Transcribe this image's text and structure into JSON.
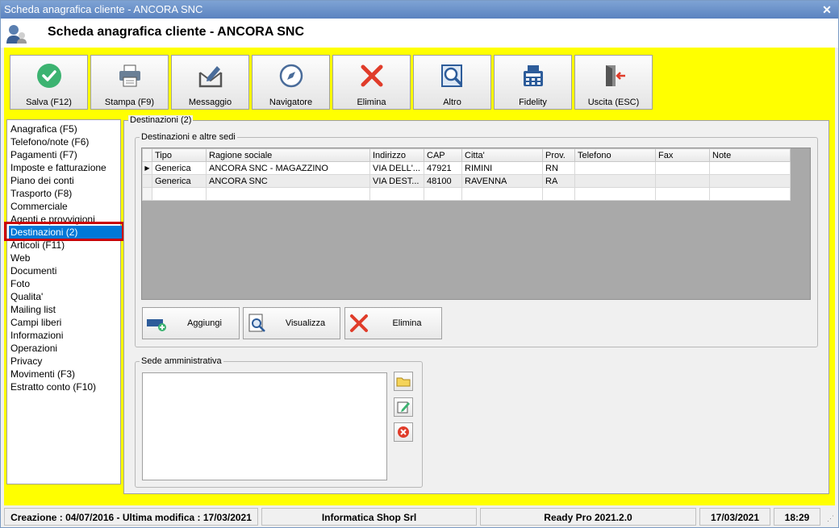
{
  "window": {
    "title": "Scheda anagrafica cliente - ANCORA SNC"
  },
  "header": {
    "title": "Scheda anagrafica cliente - ANCORA SNC"
  },
  "toolbar": [
    {
      "label": "Salva (F12)",
      "icon": "check-icon"
    },
    {
      "label": "Stampa (F9)",
      "icon": "printer-icon"
    },
    {
      "label": "Messaggio",
      "icon": "message-icon"
    },
    {
      "label": "Navigatore",
      "icon": "compass-icon"
    },
    {
      "label": "Elimina",
      "icon": "delete-icon"
    },
    {
      "label": "Altro",
      "icon": "search-doc-icon"
    },
    {
      "label": "Fidelity",
      "icon": "cash-register-icon"
    },
    {
      "label": "Uscita (ESC)",
      "icon": "exit-icon"
    }
  ],
  "nav": {
    "items": [
      "Anagrafica (F5)",
      "Telefono/note (F6)",
      "Pagamenti (F7)",
      "Imposte e fatturazione",
      "Piano dei conti",
      "Trasporto (F8)",
      "Commerciale",
      "Agenti e provvigioni",
      "Destinazioni (2)",
      "Articoli (F11)",
      "Web",
      "Documenti",
      "Foto",
      "Qualita'",
      "Mailing list",
      "Campi liberi",
      "Informazioni",
      "Operazioni",
      "Privacy",
      "Movimenti (F3)",
      "Estratto conto (F10)"
    ],
    "selected": "Destinazioni (2)"
  },
  "panel": {
    "title": "Destinazioni (2)",
    "group_title": "Destinazioni e altre sedi",
    "admin_title": "Sede amministrativa"
  },
  "table": {
    "columns": [
      "Tipo",
      "Ragione sociale",
      "Indirizzo",
      "CAP",
      "Citta'",
      "Prov.",
      "Telefono",
      "Fax",
      "Note"
    ],
    "rows": [
      [
        "Generica",
        "ANCORA SNC - MAGAZZINO",
        "VIA DELL'...",
        "47921",
        "RIMINI",
        "RN",
        "",
        "",
        ""
      ],
      [
        "Generica",
        "ANCORA SNC",
        "VIA DEST...",
        "48100",
        "RAVENNA",
        "RA",
        "",
        "",
        ""
      ]
    ]
  },
  "actions": {
    "add": "Aggiungi",
    "view": "Visualizza",
    "delete": "Elimina"
  },
  "status": {
    "dates": "Creazione : 04/07/2016 - Ultima modifica : 17/03/2021",
    "company": "Informatica Shop Srl",
    "product": "Ready Pro 2021.2.0",
    "date": "17/03/2021",
    "time": "18:29"
  }
}
